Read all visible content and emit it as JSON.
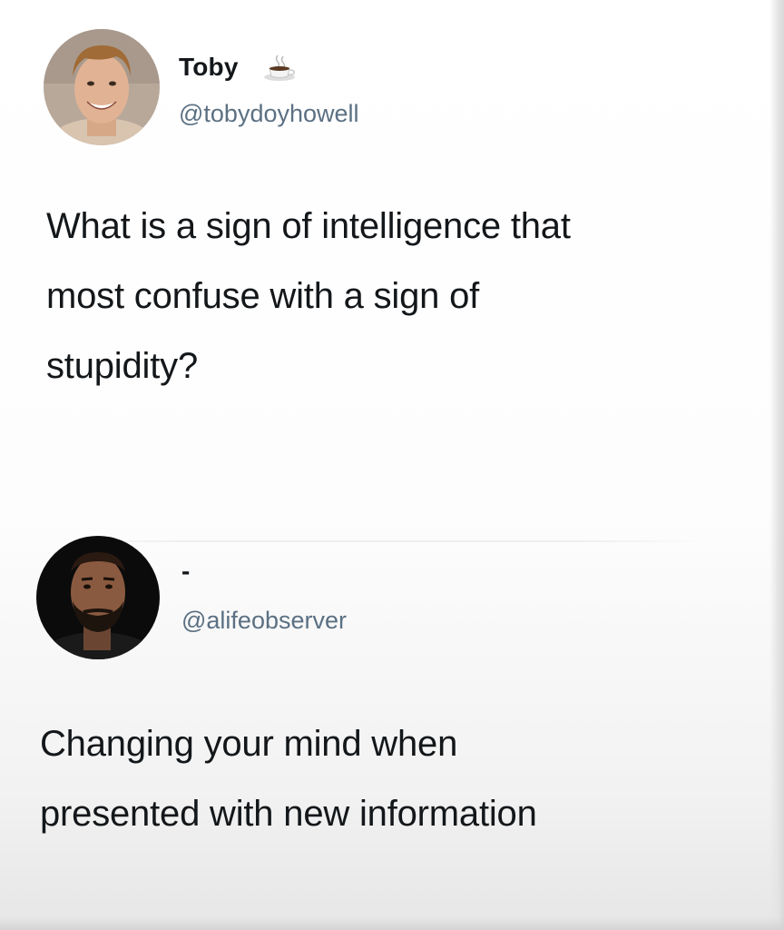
{
  "tweets": [
    {
      "display_name": "Toby",
      "name_emoji": "coffee-cup-icon",
      "handle": "@tobydoyhowell",
      "avatar": "avatar-toby",
      "lines": [
        "What is a sign of intelligence that",
        "most confuse with a sign of",
        "stupidity?"
      ]
    },
    {
      "display_name": "-",
      "handle": "@alifeobserver",
      "avatar": "avatar-alifeobserver",
      "lines": [
        "Changing your mind when",
        "presented with new information"
      ]
    }
  ],
  "colors": {
    "text": "#14171a",
    "handle": "#5b7083",
    "background": "#ffffff"
  }
}
